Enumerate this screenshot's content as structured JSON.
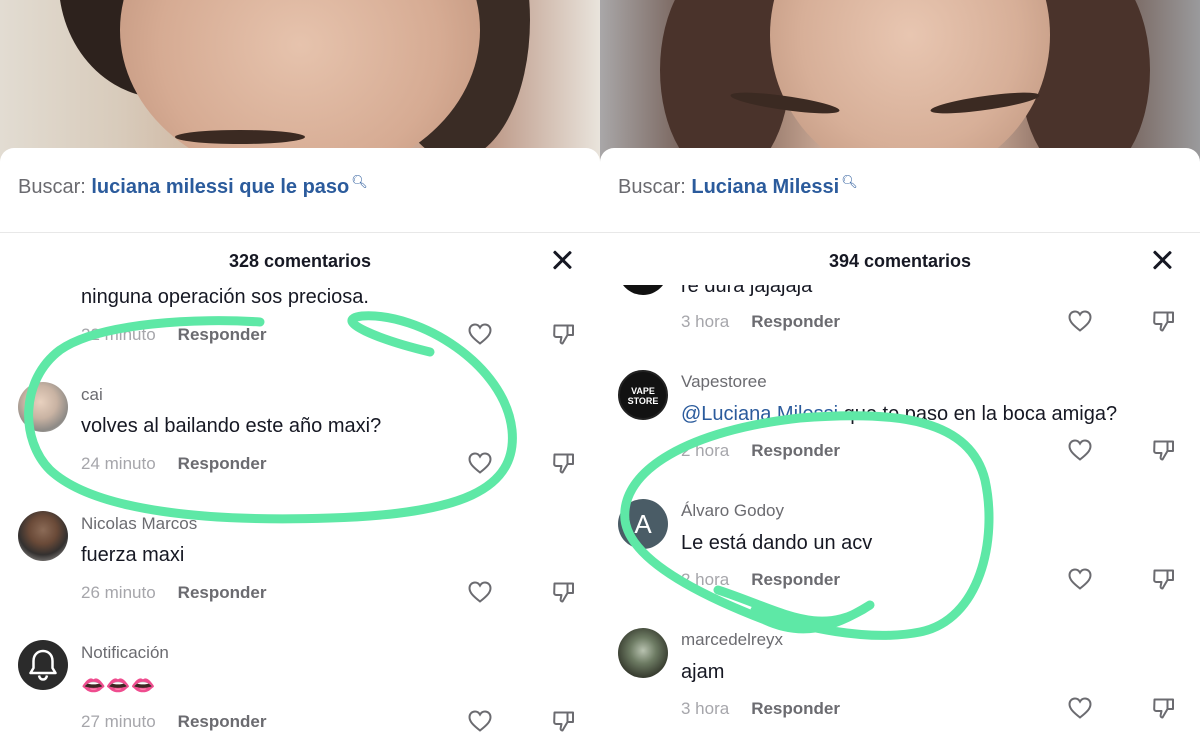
{
  "left": {
    "search": {
      "prefix": "Buscar:",
      "query": "luciana milessi que le paso"
    },
    "comment_count": "328 comentarios",
    "comments": [
      {
        "text": "ninguna operación sos preciosa.",
        "time": "22 minuto",
        "reply": "Responder"
      },
      {
        "username": "cai",
        "text": "volves al bailando este año maxi?",
        "time": "24 minuto",
        "reply": "Responder"
      },
      {
        "username": "Nicolas Marcos",
        "text": "fuerza maxi",
        "time": "26 minuto",
        "reply": "Responder"
      },
      {
        "username": "Notificación",
        "text": "👄👄👄",
        "time": "27 minuto",
        "reply": "Responder"
      }
    ]
  },
  "right": {
    "search": {
      "prefix": "Buscar:",
      "query": "Luciana Milessi"
    },
    "comment_count": "394 comentarios",
    "comments": [
      {
        "text": "re dura jajajaja",
        "time": "3 hora",
        "reply": "Responder"
      },
      {
        "username": "Vapestoree",
        "mention": "@Luciana Milessi",
        "text": " que te paso en la boca amiga?",
        "time": "2 hora",
        "reply": "Responder",
        "avatar_text": "VAPE STORE"
      },
      {
        "username": "Álvaro Godoy",
        "avatar_initial": "A",
        "text": "Le está dando un acv",
        "time": "2 hora",
        "reply": "Responder"
      },
      {
        "username": "marcedelreyx",
        "text": "ajam",
        "time": "3 hora",
        "reply": "Responder"
      }
    ]
  },
  "colors": {
    "annotation": "#5ee8a6",
    "link": "#2b5b9c",
    "muted": "#a6a6ab"
  },
  "icons": [
    "search-icon",
    "close-icon",
    "heart-icon",
    "dislike-icon",
    "bell-icon"
  ]
}
